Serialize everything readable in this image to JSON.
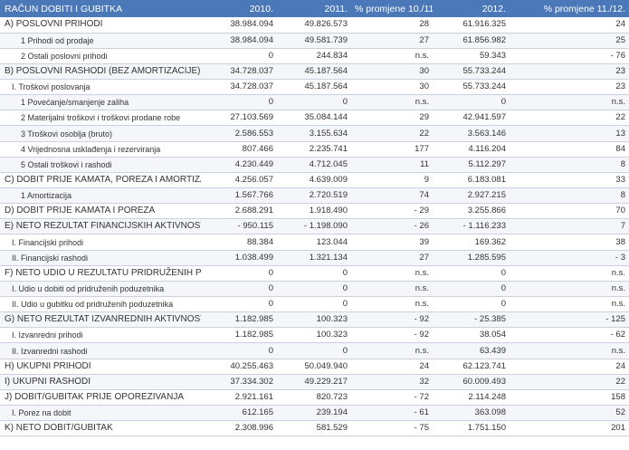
{
  "header": [
    "RAČUN DOBITI I GUBITKA",
    "2010.",
    "2011.",
    "% promjene 10./11.",
    "2012.",
    "% promjene 11./12."
  ],
  "rows": [
    {
      "level": "section",
      "cells": [
        "A) POSLOVNI PRIHODI",
        "38.984.094",
        "49.826.573",
        "28",
        "61.916.325",
        "24"
      ]
    },
    {
      "level": "l2",
      "cells": [
        "1 Prihodi od prodaje",
        "38.984.094",
        "49.581.739",
        "27",
        "61.856.982",
        "25"
      ]
    },
    {
      "level": "l2",
      "cells": [
        "2 Ostali poslovni prihodi",
        "0",
        "244.834",
        "n.s.",
        "59.343",
        "- 76"
      ]
    },
    {
      "level": "section",
      "cells": [
        "B) POSLOVNI RASHODI (BEZ AMORTIZACIJE)",
        "34.728.037",
        "45.187.564",
        "30",
        "55.733.244",
        "23"
      ]
    },
    {
      "level": "l1",
      "cells": [
        "I. Troškovi poslovanja",
        "34.728.037",
        "45.187.564",
        "30",
        "55.733.244",
        "23"
      ]
    },
    {
      "level": "l2",
      "cells": [
        "1 Povećanje/smanjenje zaliha",
        "0",
        "0",
        "n.s.",
        "0",
        "n.s."
      ]
    },
    {
      "level": "l2",
      "cells": [
        "2 Materijalni troškovi i troškovi prodane robe",
        "27.103.569",
        "35.084.144",
        "29",
        "42.941.597",
        "22"
      ]
    },
    {
      "level": "l2",
      "cells": [
        "3 Troškovi osoblja (bruto)",
        "2.586.553",
        "3.155.634",
        "22",
        "3.563.146",
        "13"
      ]
    },
    {
      "level": "l2",
      "cells": [
        "4 Vrijednosna usklađenja i rezerviranja",
        "807.466",
        "2.235.741",
        "177",
        "4.116.204",
        "84"
      ]
    },
    {
      "level": "l2",
      "cells": [
        "5 Ostali troškovi i rashodi",
        "4.230.449",
        "4.712.045",
        "11",
        "5.112.297",
        "8"
      ]
    },
    {
      "level": "section",
      "cells": [
        "C) DOBIT PRIJE KAMATA, POREZA I AMORTIZACIJE",
        "4.256.057",
        "4.639.009",
        "9",
        "6.183.081",
        "33"
      ]
    },
    {
      "level": "l2",
      "cells": [
        "1 Amortizacija",
        "1.567.766",
        "2.720.519",
        "74",
        "2.927.215",
        "8"
      ]
    },
    {
      "level": "section",
      "cells": [
        "D) DOBIT PRIJE KAMATA I POREZA",
        "2.688.291",
        "1.918.490",
        "- 29",
        "3.255.866",
        "70"
      ]
    },
    {
      "level": "section",
      "cells": [
        "E) NETO REZULTAT FINANCIJSKIH AKTIVNOSTI",
        "- 950.115",
        "- 1.198.090",
        "- 26",
        "- 1.116.233",
        "7"
      ]
    },
    {
      "level": "l1",
      "cells": [
        "I. Financijski prihodi",
        "88.384",
        "123.044",
        "39",
        "169.362",
        "38"
      ]
    },
    {
      "level": "l1",
      "cells": [
        "II. Financijski rashodi",
        "1.038.499",
        "1.321.134",
        "27",
        "1.285.595",
        "- 3"
      ]
    },
    {
      "level": "section",
      "cells": [
        "F) NETO UDIO U REZULTATU PRIDRUŽENIH PODUZETNIKA",
        "0",
        "0",
        "n.s.",
        "0",
        "n.s."
      ]
    },
    {
      "level": "l1",
      "cells": [
        "I. Udio u dobiti od pridruženih poduzetnika",
        "0",
        "0",
        "n.s.",
        "0",
        "n.s."
      ]
    },
    {
      "level": "l1",
      "cells": [
        "II. Udio u gubitku od pridruženih poduzetnika",
        "0",
        "0",
        "n.s.",
        "0",
        "n.s."
      ]
    },
    {
      "level": "section",
      "cells": [
        "G) NETO REZULTAT IZVANREDNIH AKTIVNOSTI",
        "1.182.985",
        "100.323",
        "- 92",
        "- 25.385",
        "- 125"
      ]
    },
    {
      "level": "l1",
      "cells": [
        "I. Izvanredni prihodi",
        "1.182.985",
        "100.323",
        "- 92",
        "38.054",
        "- 62"
      ]
    },
    {
      "level": "l1",
      "cells": [
        "II. Izvanredni rashodi",
        "0",
        "0",
        "n.s.",
        "63.439",
        "n.s."
      ]
    },
    {
      "level": "section",
      "cells": [
        "H) UKUPNI PRIHODI",
        "40.255.463",
        "50.049.940",
        "24",
        "62.123.741",
        "24"
      ]
    },
    {
      "level": "section",
      "cells": [
        "I) UKUPNI RASHODI",
        "37.334.302",
        "49.229.217",
        "32",
        "60.009.493",
        "22"
      ]
    },
    {
      "level": "section",
      "cells": [
        "J) DOBIT/GUBITAK PRIJE OPOREZIVANJA",
        "2.921.161",
        "820.723",
        "- 72",
        "2.114.248",
        "158"
      ]
    },
    {
      "level": "l1",
      "cells": [
        "I. Porez na dobit",
        "612.165",
        "239.194",
        "- 61",
        "363.098",
        "52"
      ]
    },
    {
      "level": "section",
      "cells": [
        "K) NETO DOBIT/GUBITAK",
        "2.308.996",
        "581.529",
        "- 75",
        "1.751.150",
        "201"
      ]
    }
  ]
}
